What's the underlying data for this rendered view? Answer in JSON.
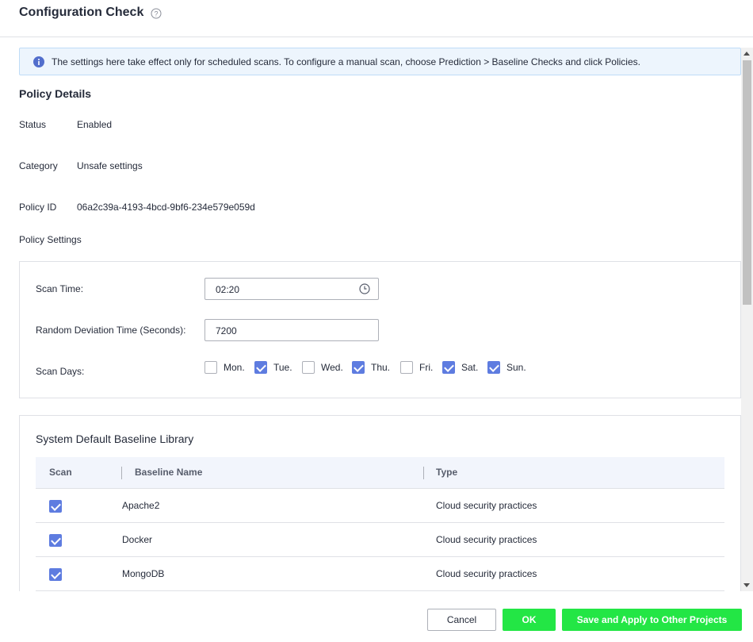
{
  "header": {
    "title": "Configuration Check"
  },
  "notice": {
    "text": "The settings here take effect only for scheduled scans. To configure a manual scan, choose Prediction > Baseline Checks and click Policies."
  },
  "policy_details": {
    "title": "Policy Details",
    "rows": [
      {
        "label": "Status",
        "value": "Enabled"
      },
      {
        "label": "Category",
        "value": "Unsafe settings"
      },
      {
        "label": "Policy ID",
        "value": "06a2c39a-4193-4bcd-9bf6-234e579e059d"
      }
    ]
  },
  "policy_settings": {
    "title": "Policy Settings",
    "scan_time_label": "Scan Time:",
    "scan_time_value": "02:20",
    "deviation_label": "Random Deviation Time (Seconds):",
    "deviation_value": "7200",
    "scan_days_label": "Scan Days:",
    "days": [
      {
        "label": "Mon.",
        "checked": false
      },
      {
        "label": "Tue.",
        "checked": true
      },
      {
        "label": "Wed.",
        "checked": false
      },
      {
        "label": "Thu.",
        "checked": true
      },
      {
        "label": "Fri.",
        "checked": false
      },
      {
        "label": "Sat.",
        "checked": true
      },
      {
        "label": "Sun.",
        "checked": true
      }
    ]
  },
  "library": {
    "title": "System Default Baseline Library",
    "columns": [
      "Scan",
      "Baseline Name",
      "Type"
    ],
    "rows": [
      {
        "checked": true,
        "name": "Apache2",
        "type": "Cloud security practices"
      },
      {
        "checked": true,
        "name": "Docker",
        "type": "Cloud security practices"
      },
      {
        "checked": true,
        "name": "MongoDB",
        "type": "Cloud security practices"
      }
    ]
  },
  "footer": {
    "cancel_label": "Cancel",
    "ok_label": "OK",
    "save_label": "Save and Apply to Other Projects"
  },
  "colors": {
    "primary_green": "#23e645",
    "checkbox_blue": "#5e7ce0",
    "notice_bg": "#edf5fd",
    "info_blue": "#526ecc"
  }
}
